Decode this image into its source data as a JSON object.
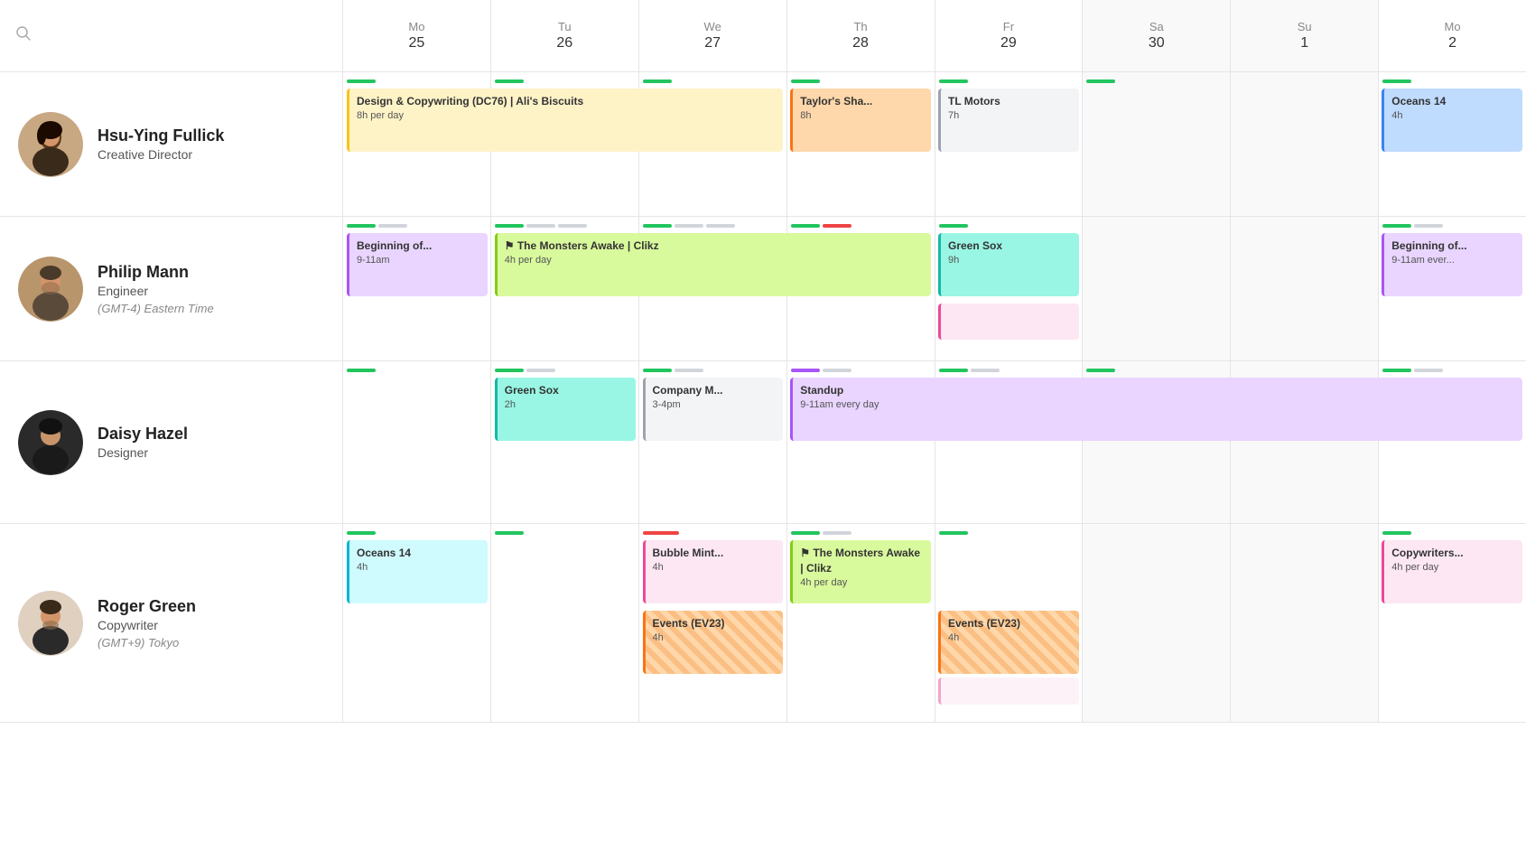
{
  "header": {
    "search_placeholder": "Search",
    "days": [
      {
        "name": "Mo",
        "num": "25",
        "weekend": false
      },
      {
        "name": "Tu",
        "num": "26",
        "weekend": false
      },
      {
        "name": "We",
        "num": "27",
        "weekend": false
      },
      {
        "name": "Th",
        "num": "28",
        "weekend": false
      },
      {
        "name": "Fr",
        "num": "29",
        "weekend": false
      },
      {
        "name": "Sa",
        "num": "30",
        "weekend": true
      },
      {
        "name": "Su",
        "num": "1",
        "weekend": true
      },
      {
        "name": "Mo",
        "num": "2",
        "weekend": false
      }
    ]
  },
  "people": [
    {
      "id": "hsu-ying",
      "name": "Hsu-Ying Fullick",
      "role": "Creative Director",
      "tz": null
    },
    {
      "id": "philip",
      "name": "Philip Mann",
      "role": "Engineer",
      "tz": "(GMT-4) Eastern Time"
    },
    {
      "id": "daisy",
      "name": "Daisy Hazel",
      "role": "Designer",
      "tz": null
    },
    {
      "id": "roger",
      "name": "Roger Green",
      "role": "Copywriter",
      "tz": "(GMT+9) Tokyo"
    }
  ],
  "events": {
    "hsu_ying": {
      "mon_event": {
        "title": "Design & Copywriting (DC76) | Ali's Biscuits",
        "sub": "8h per day",
        "color": "yellow",
        "span": "mon-wed"
      },
      "thu_event": {
        "title": "Taylor's Sha...",
        "sub": "8h",
        "color": "orange"
      },
      "fri_event": {
        "title": "TL Motors",
        "sub": "7h",
        "color": "gray"
      },
      "mon2_event": {
        "title": "Oceans 14",
        "sub": "4h",
        "color": "blue-light"
      }
    },
    "philip": {
      "mon_event": {
        "title": "Beginning of...",
        "sub": "9-11am",
        "color": "purple"
      },
      "tue_thu_event": {
        "title": "The Monsters Awake | Clikz",
        "sub": "4h per day",
        "color": "green-light",
        "span": "tue-thu"
      },
      "fri_event": {
        "title": "Green Sox",
        "sub": "9h",
        "color": "teal"
      },
      "mon2_event": {
        "title": "Beginning of...",
        "sub": "9-11am ever...",
        "color": "purple"
      }
    },
    "daisy": {
      "tue_event": {
        "title": "Green Sox",
        "sub": "2h",
        "color": "teal"
      },
      "wed_event": {
        "title": "Company M...",
        "sub": "3-4pm",
        "color": "gray"
      },
      "thu_sun_event": {
        "title": "Standup",
        "sub": "9-11am every day",
        "color": "purple",
        "span": "thu-sun+"
      }
    },
    "roger": {
      "mon_event": {
        "title": "Oceans 14",
        "sub": "4h",
        "color": "cyan"
      },
      "wed_event1": {
        "title": "Bubble Mint...",
        "sub": "4h",
        "color": "pink"
      },
      "wed_event2": {
        "title": "Events (EV23)",
        "sub": "4h",
        "color": "orange-hatch"
      },
      "thu_event": {
        "title": "The Monsters Awake | Clikz",
        "sub": "4h per day",
        "color": "green-light"
      },
      "fri_event": {
        "title": "Events (EV23)",
        "sub": "4h",
        "color": "orange-hatch"
      },
      "mon2_event": {
        "title": "Copywriters...",
        "sub": "4h per day",
        "color": "pink"
      }
    }
  },
  "ui": {
    "search_icon": "🔍",
    "flag_icon": "⚑"
  }
}
